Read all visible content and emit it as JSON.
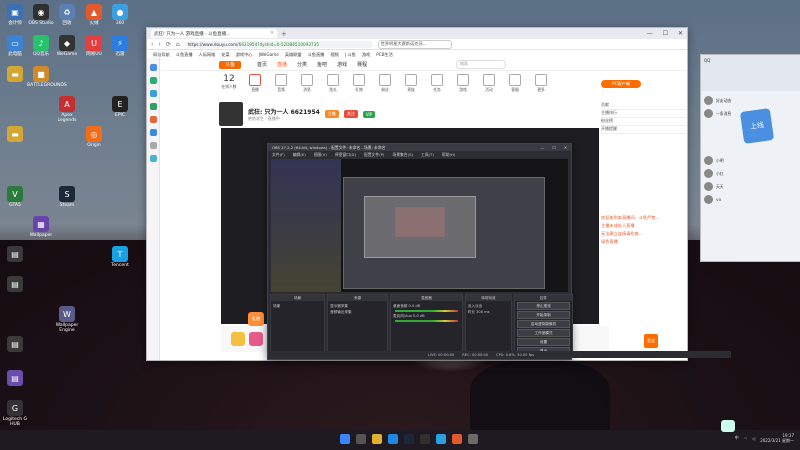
{
  "desktop": {
    "icons": [
      {
        "label": "会计师",
        "color": "#3b6fb6",
        "glyph": "▣"
      },
      {
        "label": "OBS Studio",
        "color": "#303030",
        "glyph": "◉"
      },
      {
        "label": "回收",
        "color": "#5a7fb0",
        "glyph": "♻"
      },
      {
        "label": "火绒",
        "color": "#e15a2b",
        "glyph": "▲"
      },
      {
        "label": "360",
        "color": "#3ca0e0",
        "glyph": "●"
      },
      {
        "label": "此电脑",
        "color": "#3b82d6",
        "glyph": "▭"
      },
      {
        "label": "QQ音乐",
        "color": "#28c06a",
        "glyph": "♪"
      },
      {
        "label": "WeGame",
        "color": "#333",
        "glyph": "◆"
      },
      {
        "label": "网易UU",
        "color": "#e63e3e",
        "glyph": "U"
      },
      {
        "label": "迅雷",
        "color": "#2a7de1",
        "glyph": "⚡"
      },
      {
        "label": "BATTLEGROUNDS",
        "color": "#d08a2a",
        "glyph": "■"
      },
      {
        "label": "Apex Legends",
        "color": "#c23030",
        "glyph": "A"
      },
      {
        "label": "EPIC",
        "color": "#222",
        "glyph": "E"
      },
      {
        "label": "Origin",
        "color": "#f26c1a",
        "glyph": "◎"
      },
      {
        "label": "GTA5",
        "color": "#2c7a3b",
        "glyph": "V"
      },
      {
        "label": "Steam",
        "color": "#1b2838",
        "glyph": "S"
      },
      {
        "label": "Wallpaper",
        "color": "#6644aa",
        "glyph": "▦"
      },
      {
        "label": "Tencent",
        "color": "#1aa0e6",
        "glyph": "T"
      },
      {
        "label": "Wallpaper Engine",
        "color": "#5a5a8a",
        "glyph": "W"
      },
      {
        "label": "Logitech G HUB",
        "color": "#333",
        "glyph": "G"
      }
    ]
  },
  "browser": {
    "tab_title": "武狂! 只为一人 游戏直播 - 斗鱼直播...",
    "window_controls": [
      "—",
      "☐",
      "✕"
    ],
    "url_host": "https://www.douyu.com/",
    "url_path": "6621954?dyshid=0-52DB6510093735",
    "search_placeholder": "世界明星大赛斯诺克冠...",
    "bookmarks": [
      "网址导航",
      "斗鱼直播",
      "人际网络",
      "花菜",
      "游戏中心",
      "|WeGame",
      "英雄联盟",
      "斗鱼直播",
      "视频",
      "| 斗鱼",
      "游戏",
      "PCB生活"
    ]
  },
  "site": {
    "logo": "斗鱼",
    "nav": [
      {
        "label": "首页",
        "active": false
      },
      {
        "label": "直播",
        "active": true
      },
      {
        "label": "分类",
        "active": false
      },
      {
        "label": "鱼吧",
        "active": false
      },
      {
        "label": "游戏",
        "active": false
      },
      {
        "label": "赛程",
        "active": false
      }
    ],
    "search_placeholder": "搜索",
    "categories": [
      {
        "label": "12",
        "sub": "在线人数"
      },
      {
        "label": "直播",
        "sub": "直播"
      },
      {
        "label": "音频",
        "sub": "音频"
      },
      {
        "label": "消息",
        "sub": "消息"
      },
      {
        "label": "鱼丸",
        "sub": "鱼丸"
      },
      {
        "label": "礼物",
        "sub": "礼物"
      },
      {
        "label": "粉丝",
        "sub": "粉丝"
      },
      {
        "label": "贵族",
        "sub": "贵族"
      },
      {
        "label": "任务",
        "sub": "任务"
      },
      {
        "label": "游戏",
        "sub": "游戏"
      },
      {
        "label": "活动",
        "sub": "活动"
      },
      {
        "label": "客服",
        "sub": "客服"
      },
      {
        "label": "更多",
        "sub": "更多"
      }
    ],
    "pc_button": "PC客户端",
    "room_title": "武狂: 只为一人 6621954",
    "room_sub": "绝地求生 · 直播中",
    "tags": [
      {
        "label": "主播",
        "color": "#f58a2a"
      },
      {
        "label": "关注",
        "color": "#e84a3c"
      },
      {
        "label": "VIP",
        "color": "#2ca54a"
      }
    ],
    "right_panel": [
      "贡献",
      "主播排行",
      "粉丝榜",
      "开播提醒"
    ],
    "chat_lines": [
      "欢迎来到本直播间，斗鱼严禁...",
      "主播未成年人直播",
      "无法建立连接请检查...",
      "绿色直播"
    ],
    "send_label": "发送",
    "gift_ad": "礼物"
  },
  "obs": {
    "title": "OBS 27.2.2 (64-bit, windows) - 配置文件: 未命名 - 场景: 未命名",
    "window_controls": [
      "—",
      "☐",
      "✕"
    ],
    "menu": [
      "文件(F)",
      "编辑(E)",
      "视图(V)",
      "停靠窗口(D)",
      "配置文件(P)",
      "场景集合(S)",
      "工具(T)",
      "帮助(H)"
    ],
    "docks": [
      {
        "title": "场景",
        "items": [
          "场景"
        ]
      },
      {
        "title": "来源",
        "items": [
          "显示器采集",
          "音频输出采集"
        ]
      },
      {
        "title": "混音器",
        "items": [
          "桌面音频 0.0 dB",
          "麦克风/Aux 0.0 dB"
        ]
      },
      {
        "title": "转场特效",
        "items": [
          "淡入淡出",
          "时长 300 ms"
        ]
      },
      {
        "title": "控件",
        "items": [
          "停止推流",
          "开始录制",
          "启动虚拟摄像机",
          "工作室模式",
          "设置",
          "退出"
        ]
      }
    ],
    "status": [
      "LIVE: 00:00:00",
      "REC: 00:00:00",
      "CPU: 0.8%, 30.00 fps"
    ]
  },
  "qq": {
    "title": "QQ",
    "contacts": [
      "好友动态",
      "一条消息",
      "小明",
      "小红",
      "天天",
      "VX"
    ],
    "badge": "上线"
  },
  "taskbar": {
    "lang": "中",
    "time": "19:37",
    "date": "2022/3/21 星期一"
  }
}
